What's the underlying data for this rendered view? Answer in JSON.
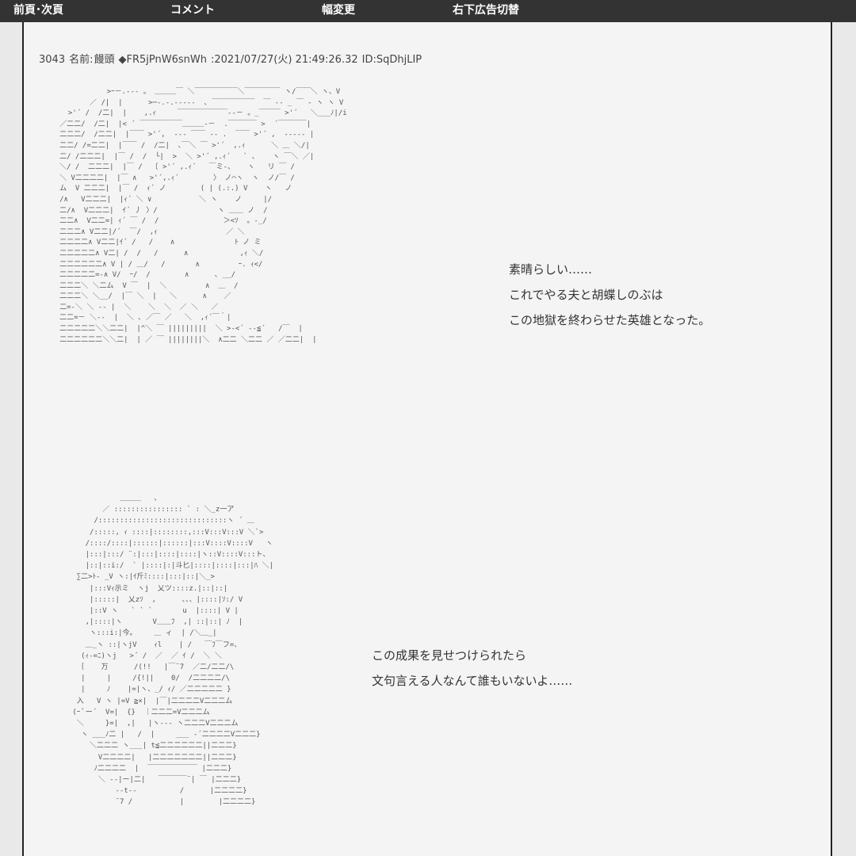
{
  "nav": {
    "prev_next": "前頁･次頁",
    "comment": "コメント",
    "width_change": "幅変更",
    "ad_toggle": "右下広告切替"
  },
  "post": {
    "number": "3043",
    "name_label": "名前:",
    "name": "饅頭",
    "trip": "◆FR5jPnW6snWh",
    "date": ":2021/07/27(火) 21:49:26.32",
    "id": "ID:SqDhjLIP"
  },
  "scene1": {
    "aa": "                >ｰ－.‐‐- 。 ＿＿＿￣ ＼￣￣￣￣￣￣＼￣￣￣￣￣ ヽ/￣￣＼ ヽ、V\n            ／ /|  |      >─‐.-.‐‐‐‐-  ､ ￣￣￣￣￣￣  ￣ ‐- _ ￣ ‐ ヽ ヽ V\n       >'´ /  /二|  |    ,.ｨ     ￣￣￣￣￣￣￣‐‐－ 。_￣￣￣ >'´   ＼___ﾉ|/i\n     ／二二/  /二|  |< ´ ￣￣￣￣￣￣＿＿＿‐－  .￣￣￣￣ >  ´￣￣￣￣|\n     二二二/  /二二|  |￣￣ >'´,  -‐‐ ￣￣ ‐- .  ￣￣ >'´ ,  -‐‐‐‐ |\n     二二/ /=二二|  |￣￣ /  /二|  ､￣＼ ￣ >'´  ,.ｨ      ＼ ＿ ＼/|\n     二/ /二二二|  |￣ /  /  └|  >  ＼ >'´ ,.ｨ´   ` ､    ヽ ￣＼ ／|\n     ＼/ /  二二二|  |￣ /  〔 >'´ ,.ｨ´   ￣ミ-、   ヽ   リ ￣ /\n     ＼ V二二二二|  |￣ ∧   >'´,.ｨ´        〉 ノ⌒ヽ  ヽ  ノ/￣ /\n     ム  V 二二二|  |￣ /  ｨ´ ノ        ( | (.:.) V    ヽ   ノ\n     /∧   V二二二|  |ｨ´ ＼ ∨           ＼ ヽ    ノ     |/\n     二/∧  V二二二|  ｲ´ 丿 〉/              ヽ ＿＿ ノ  /\n     二二∧  V二二=| ｨ´ ￣ /  /               ＞<ｿ  。-_/\n     二二二∧ V二二|/´  ￣/  ,ｨ                ／ ＼\n     二二二二∧ V二二|ｲ´ /   /    ∧              ﾄ ノ ミ\n     二二二二二∧ V二| /  /   /      ∧            ,ｨ ＼/\n     二二二二二二∧ V | / ＿/   /       ∧         ｰ. ｨ</\n     二二二二二=-∧ V/  ｰ/  /        ∧      ､ __/\n     二二二＼ ＼二ム  V ￣  |  ＼         ∧  ＿  /\n     二二二＼ ＼__/  |￣ ＼  |   ＼      ∧    ／\n     二=-＼ ＼ -‐ |  ＼    ＼  ＼  ／ ＼   ／\n     二二=－ ＼-‐  |  ＼ ､ ／￣ ／   ＼  ,ｨ´￣｀|\n     二二二二二＼＼二二|  |^＼ ￣ |||||||||  ＼ >-<´ ‐‐≦´   /￣  |\n     二二二二二二＼＼二|  | ／ ￣ ||||||||＼  ∧二二 ＼二二 ／ ／二二|  |"
  },
  "scene1_lines": [
    "素晴らしい……",
    "これでやる夫と胡蝶しのぶは",
    "この地獄を終わらせた英雄となった。"
  ],
  "scene2": {
    "aa": "                   ＿＿＿   、\n               ／ :::::::::::::::: ` : ＼_z一ア\n             /::::::::::::::::::::::::::::::ヽ ´ ＿\n            /:::::, ｨ ::::|::::::::,:::V:::V:::V ＼`>\n           /::::/::::|::::::|::::::|:::V::::V::::V   ヽ\n           |:::|:::/ ¨:|:::|::::|::::|ヽ::V::::V:::ト、\n           |::|::i:/  ` |::::|:|斗匕|::::|::::|:::|ﾊ ＼|\n         ∑二>ﾄ- _V ヽ:|ｲ斤ﾐ::::|:::|::|＼_>\n            |:::Vｨ示ミ  ヽj  乂ツ::::z.|::|::|\n            |:::::|  乂zｿ  ,      、、、|::::|ｿ:/ V\n            |::V ヽ   ` ` `       u  |::::| V |\n           ,|::::|ヽ       V＿＿ﾌ  ,| ::|::| ﾉ  |\n            ヽ:::i:|今。    ＿ ィ  | /＼＿_|\n           ＿_ヽ ::|ヽjV    ｨl    | /   ￣ﾌ￣フ=、\n          (ｨ‐=ﾆ)ヽj   >´ /  ／  ／ ｲ /  ＼ ＼\n         ｛    万      /(!!   |￣¨7  ／二/二二/\\ \n          |     |     /{!||    0/  /二二二二/\\ \n          |     ﾉ    |=|ヽ、_/ ｨ/ ／二二二二二 }\n         入   V ヽ |=V ≧×|  |￣|二二二二V二二二ム\n        (ｰ ﾟー´  V=|  {}  ｜二二二=V二二二ム\n         ＼     }=|  ,|   |ヽ‐‐- ヽ二二二V二二二ム\n          ヽ ___ﾉ二 |   /  |     ___ ‐´二二二二V二二二}\n            ＼二二二 ヽ___| t≦二二二二二二||二二二}\n              V二二二二|   |二二二二二二二||二二二}\n             ﾉ二二二二  |  ￣￣￣￣￣￣￣ |二二二}\n              ＼ -‐|ー|二|   ￣￣￣￣¨| ￣ |二二二}\n                  ‐‐t‐‐          /      |二二二二}\n                  ¨7 /           |        |二二二二}"
  },
  "scene2_lines": [
    "この成果を見せつけられたら",
    "文句言える人なんて誰もいないよ……"
  ],
  "colors": {
    "topbar_bg": "#333333",
    "topbar_text": "#ffffff",
    "page_bg": "#f4f4f4",
    "outer_bg": "#e9e9e9",
    "text": "#333333"
  }
}
